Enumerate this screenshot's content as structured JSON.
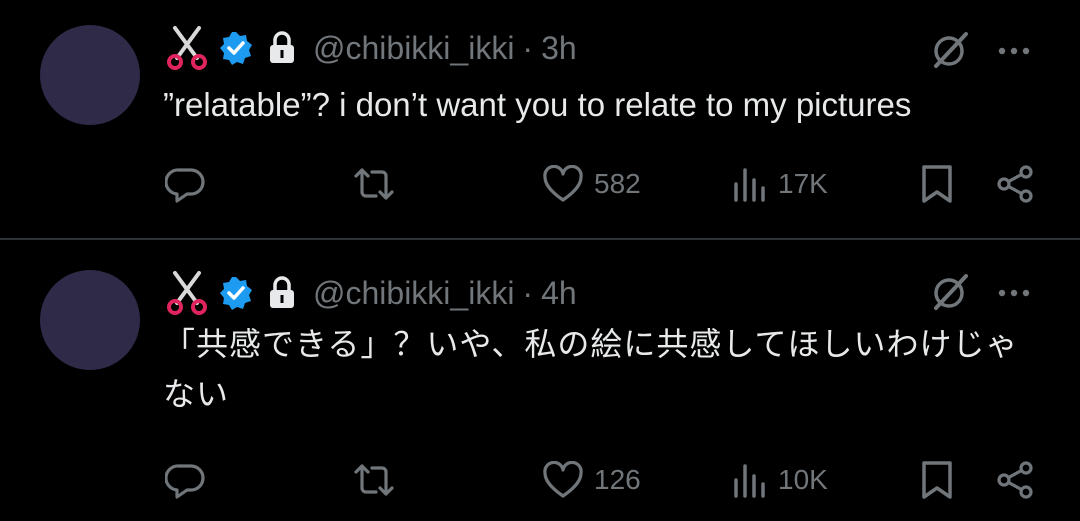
{
  "tweets": [
    {
      "handle": "@chibikki_ikki",
      "separator": "·",
      "time": "3h",
      "text": "”relatable”? i don’t want you to relate to my pictures",
      "likes": "582",
      "views": "17K"
    },
    {
      "handle": "@chibikki_ikki",
      "separator": "·",
      "time": "4h",
      "text": "「共感できる」？いや、私の絵に共感してほしいわけじゃない",
      "likes": "126",
      "views": "10K"
    }
  ],
  "colors": {
    "background": "#000000",
    "text": "#e7e9ea",
    "muted": "#71767b",
    "verified": "#1d9bf0",
    "avatar": "#2e2a48",
    "divider": "#2f3336"
  },
  "icons": [
    "scissors-icon",
    "verified-badge-icon",
    "lock-icon",
    "grok-icon",
    "more-icon",
    "reply-icon",
    "retweet-icon",
    "like-icon",
    "views-icon",
    "bookmark-icon",
    "share-icon"
  ]
}
